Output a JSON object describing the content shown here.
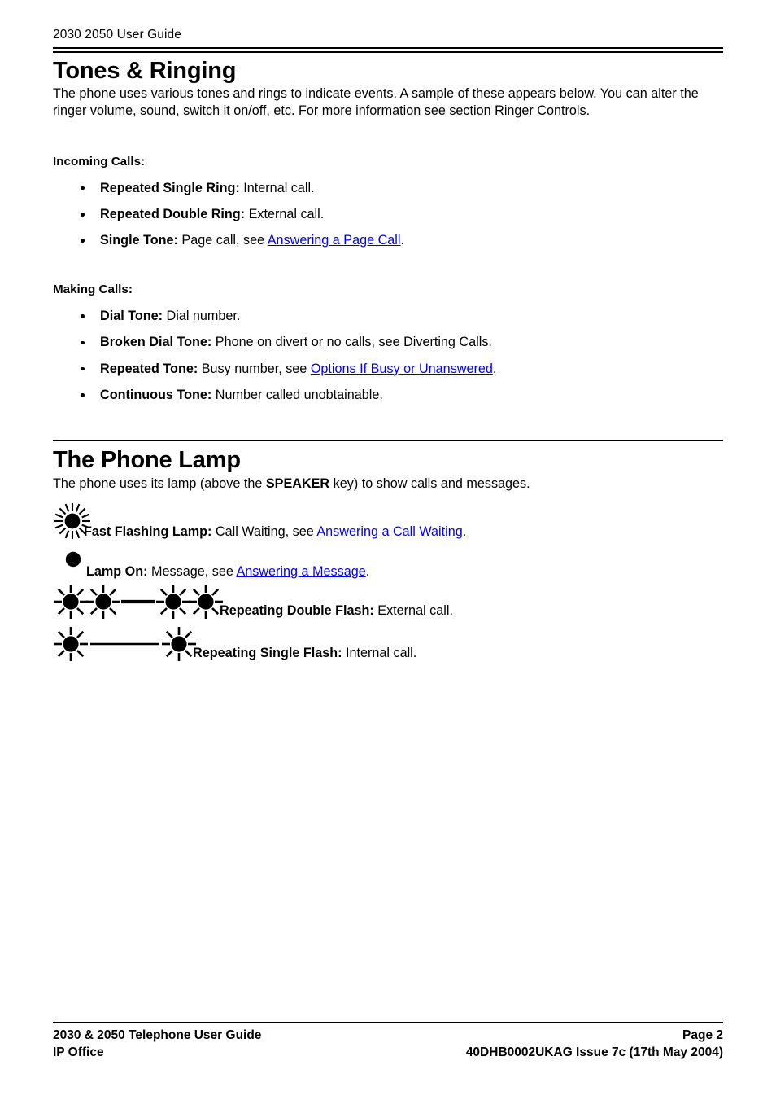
{
  "header": {
    "running_title": "2030 2050 User Guide"
  },
  "sections": [
    {
      "title": "Tones & Ringing",
      "intro": "The phone uses various tones and rings to indicate events. A sample of these appears below. You can alter the ringer volume, sound, switch it on/off, etc. For more information see section Ringer Controls.",
      "groups": [
        {
          "heading": "Incoming Calls:",
          "items": [
            {
              "label": "Repeated Single Ring:",
              "text": " Internal call.",
              "link": null,
              "tail": ""
            },
            {
              "label": "Repeated Double Ring:",
              "text": " External call.",
              "link": null,
              "tail": ""
            },
            {
              "label": "Single Tone:",
              "text": " Page call, see ",
              "link": "Answering a Page Call",
              "tail": "."
            }
          ]
        },
        {
          "heading": "Making Calls:",
          "items": [
            {
              "label": "Dial Tone:",
              "text": " Dial number.",
              "link": null,
              "tail": ""
            },
            {
              "label": "Broken Dial Tone:",
              "text": " Phone on divert or no calls, see Diverting Calls.",
              "link": null,
              "tail": ""
            },
            {
              "label": "Repeated Tone:",
              "text": " Busy number, see ",
              "link": "Options If Busy or Unanswered",
              "tail": "."
            },
            {
              "label": "Continuous Tone:",
              "text": " Number called unobtainable.",
              "link": null,
              "tail": ""
            }
          ]
        }
      ]
    }
  ],
  "lamp_section": {
    "title": "The Phone Lamp",
    "intro_before": "The phone uses its lamp (above the ",
    "intro_bold": "SPEAKER",
    "intro_after": " key) to show calls and messages.",
    "rows": [
      {
        "icon": "fast-flashing-lamp-icon",
        "label": "Fast Flashing Lamp:",
        "text": " Call Waiting, see ",
        "link": "Answering a Call Waiting",
        "tail": "."
      },
      {
        "icon": "lamp-on-icon",
        "label": "Lamp On:",
        "text": " Message, see ",
        "link": "Answering a Message",
        "tail": "."
      },
      {
        "icon": "repeating-double-flash-icon",
        "label": "Repeating Double Flash:",
        "text": " External call.",
        "link": null,
        "tail": ""
      },
      {
        "icon": "repeating-single-flash-icon",
        "label": "Repeating Single Flash:",
        "text": " Internal call.",
        "link": null,
        "tail": ""
      }
    ]
  },
  "footer": {
    "left_top": "2030 & 2050 Telephone User Guide",
    "left_bottom": "IP Office",
    "right_top": "Page 2",
    "right_bottom": "40DHB0002UKAG Issue 7c (17th May 2004)"
  },
  "colors": {
    "link": "#0000ee",
    "text": "#000000",
    "background": "#ffffff"
  }
}
